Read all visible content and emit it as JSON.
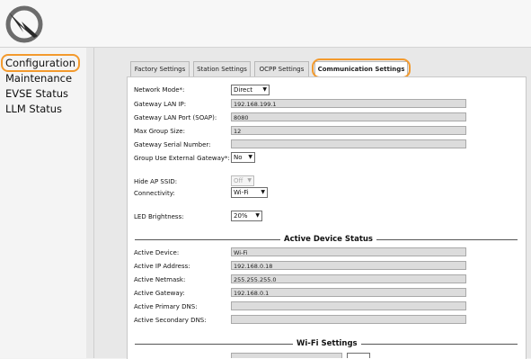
{
  "sidebar": {
    "items": [
      "Configuration",
      "Maintenance",
      "EVSE Status",
      "LLM Status"
    ]
  },
  "tabs": [
    "Factory Settings",
    "Station Settings",
    "OCPP Settings",
    "Communication Settings"
  ],
  "settings": {
    "network_mode": {
      "label": "Network Mode*:",
      "value": "Direct"
    },
    "gateway_lan_ip": {
      "label": "Gateway LAN IP:",
      "value": "192.168.199.1"
    },
    "gateway_lan_port": {
      "label": "Gateway LAN Port (SOAP):",
      "value": "8080"
    },
    "max_group_size": {
      "label": "Max Group Size:",
      "value": "12"
    },
    "gateway_serial": {
      "label": "Gateway Serial Number:",
      "value": ""
    },
    "group_external_gateway": {
      "label": "Group Use External Gateway*:",
      "value": "No"
    },
    "hide_ap_ssid": {
      "label": "Hide AP SSID:",
      "value": "Off"
    },
    "connectivity": {
      "label": "Connectivity:",
      "value": "Wi-Fi"
    },
    "led_brightness": {
      "label": "LED Brightness:",
      "value": "20%"
    }
  },
  "active_status": {
    "title": "Active Device Status",
    "device": {
      "label": "Active Device:",
      "value": "Wi-Fi"
    },
    "ip": {
      "label": "Active IP Address:",
      "value": "192.168.0.18"
    },
    "netmask": {
      "label": "Active Netmask:",
      "value": "255.255.255.0"
    },
    "gateway": {
      "label": "Active Gateway:",
      "value": "192.168.0.1"
    },
    "primary_dns": {
      "label": "Active Primary DNS:",
      "value": ""
    },
    "secondary_dns": {
      "label": "Active Secondary DNS:",
      "value": ""
    }
  },
  "wifi": {
    "title": "Wi-Fi Settings"
  },
  "colors": {
    "highlight": "#f39a2d"
  }
}
